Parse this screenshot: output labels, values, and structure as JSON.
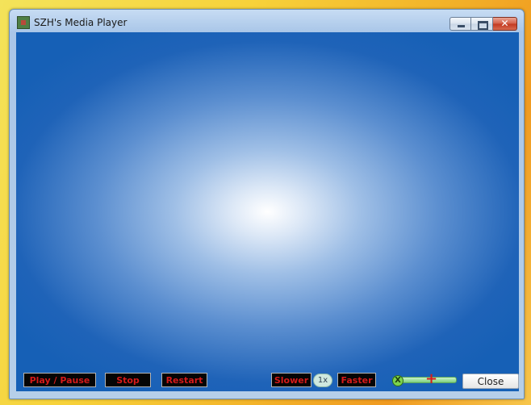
{
  "window": {
    "title": "SZH's Media Player",
    "close_glyph": "✕"
  },
  "controls": {
    "play_pause": "Play / Pause",
    "stop": "Stop",
    "restart": "Restart",
    "slower": "Slower",
    "speed": "1x",
    "faster": "Faster",
    "mute": "X",
    "volume_up": "+",
    "close": "Close"
  },
  "colors": {
    "video_center": "#ffffff",
    "video_edge": "#1660b6",
    "control_text": "#d51a1a"
  }
}
